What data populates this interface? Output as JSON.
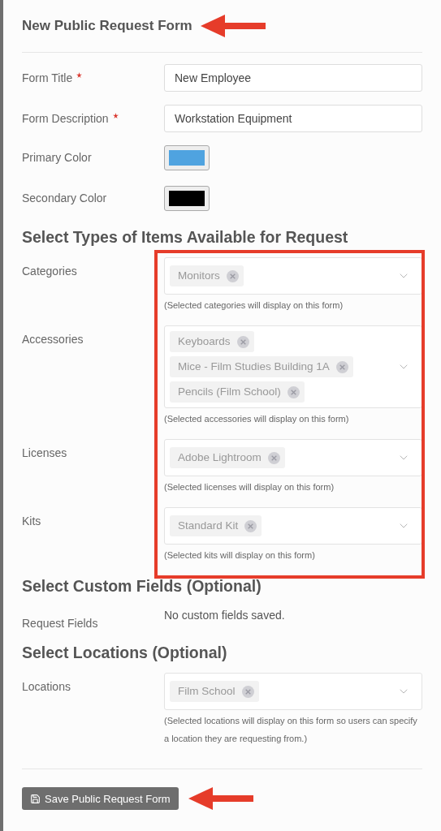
{
  "header": {
    "title": "New Public Request Form",
    "pointer_arrow": true
  },
  "fields": [
    {
      "kind": "text",
      "label": "Form Title",
      "required": true,
      "value": "New Employee"
    },
    {
      "kind": "text",
      "label": "Form Description",
      "required": true,
      "value": "Workstation Equipment"
    },
    {
      "kind": "color",
      "label": "Primary Color",
      "required": false,
      "color": "#4fa3e0"
    },
    {
      "kind": "color",
      "label": "Secondary Color",
      "required": false,
      "color": "#000000"
    }
  ],
  "sections": [
    {
      "heading": "Select Types of Items Available for Request",
      "highlighted": true,
      "rows": [
        {
          "kind": "multiselect",
          "label": "Categories",
          "chips": [
            "Monitors"
          ],
          "hint": "(Selected categories will display on this form)"
        },
        {
          "kind": "multiselect",
          "label": "Accessories",
          "chips": [
            "Keyboards",
            "Mice - Film Studies Building 1A",
            "Pencils (Film School)"
          ],
          "hint": "(Selected accessories will display on this form)"
        },
        {
          "kind": "multiselect",
          "label": "Licenses",
          "chips": [
            "Adobe Lightroom"
          ],
          "hint": "(Selected licenses will display on this form)"
        },
        {
          "kind": "multiselect",
          "label": "Kits",
          "chips": [
            "Standard Kit"
          ],
          "hint": "(Selected kits will display on this form)"
        }
      ]
    },
    {
      "heading": "Select Custom Fields (Optional)",
      "highlighted": false,
      "rows": [
        {
          "kind": "message",
          "label": "Request Fields",
          "text": "No custom fields saved."
        }
      ]
    },
    {
      "heading": "Select Locations (Optional)",
      "highlighted": false,
      "rows": [
        {
          "kind": "multiselect",
          "label": "Locations",
          "chips": [
            "Film School"
          ],
          "hint": "(Selected locations will display on this form so users can specify a location they are requesting from.)"
        }
      ]
    }
  ],
  "save_button": {
    "label": "Save Public Request Form",
    "pointer_arrow": true
  }
}
